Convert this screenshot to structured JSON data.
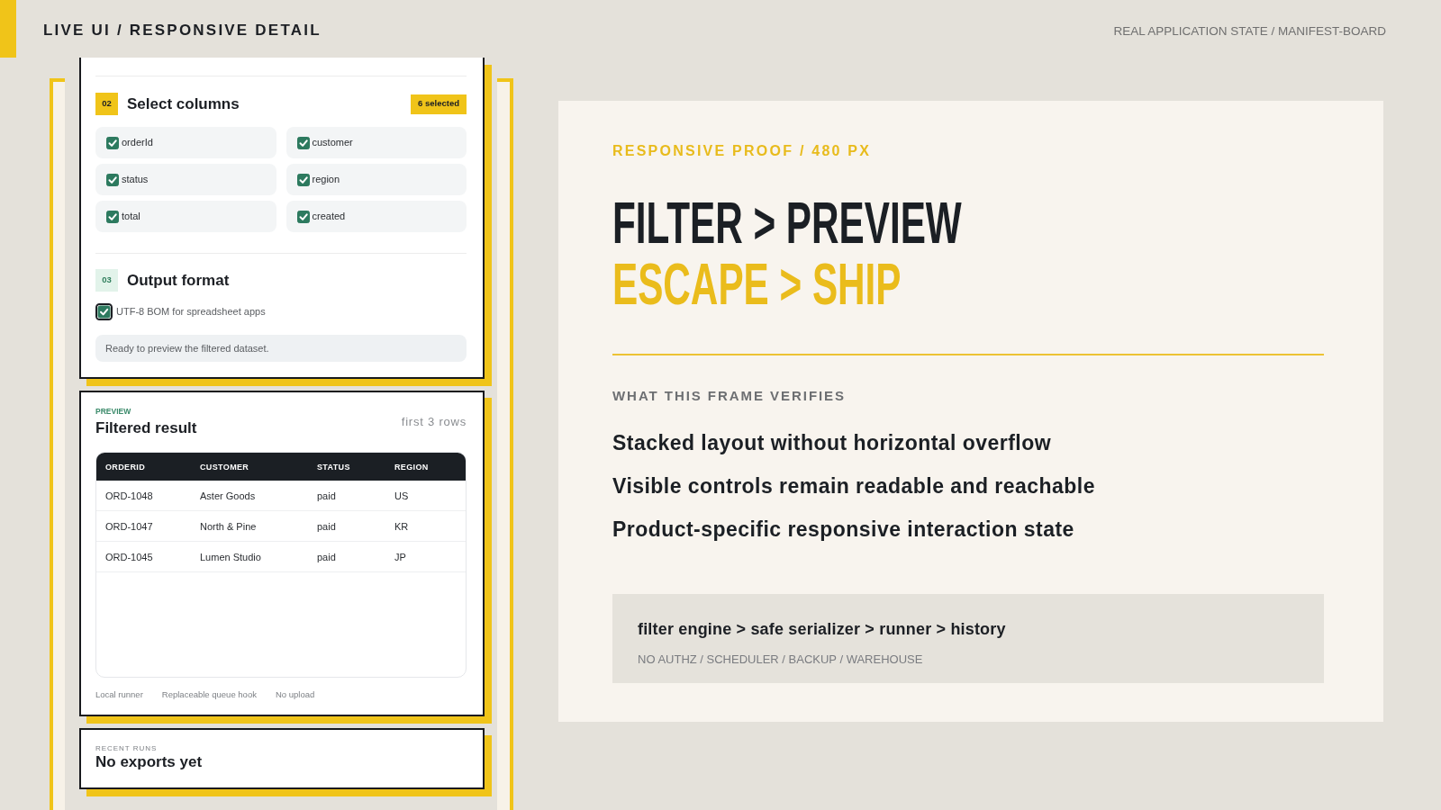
{
  "header": {
    "title": "LIVE UI / RESPONSIVE DETAIL",
    "context": "REAL APPLICATION STATE / MANIFEST-BOARD"
  },
  "device_preview": {
    "column_section": {
      "number": "02",
      "active": true,
      "title": "Select columns",
      "count_badge": "6 selected",
      "options": [
        {
          "label": "orderId",
          "checked": true
        },
        {
          "label": "customer",
          "checked": true
        },
        {
          "label": "status",
          "checked": true
        },
        {
          "label": "region",
          "checked": true
        },
        {
          "label": "total",
          "checked": true
        },
        {
          "label": "created",
          "checked": true
        }
      ]
    },
    "format_section": {
      "number": "03",
      "active": false,
      "title": "Output format",
      "option": {
        "label": "UTF-8 BOM for spreadsheet apps",
        "checked": true,
        "focused": true
      },
      "status": "Ready to preview the filtered dataset."
    },
    "preview": {
      "eyebrow": "PREVIEW",
      "title": "Filtered result",
      "meta": "first 3 rows",
      "table": {
        "columns": [
          "ORDERID",
          "CUSTOMER",
          "STATUS",
          "REGION"
        ],
        "rows": [
          [
            "ORD-1048",
            "Aster Goods",
            "paid",
            "US"
          ],
          [
            "ORD-1047",
            "North & Pine",
            "paid",
            "KR"
          ],
          [
            "ORD-1045",
            "Lumen Studio",
            "paid",
            "JP"
          ]
        ]
      },
      "notes": [
        "Local runner",
        "Replaceable queue hook",
        "No upload"
      ]
    },
    "recent_runs": {
      "eyebrow": "RECENT RUNS",
      "title": "No exports yet"
    }
  },
  "proof": {
    "eyebrow": "RESPONSIVE PROOF / 480 PX",
    "headline": [
      {
        "text": "FILTER > PREVIEW",
        "accent": false
      },
      {
        "text": "ESCAPE > SHIP",
        "accent": true
      }
    ],
    "checks_title": "WHAT THIS FRAME VERIFIES",
    "checks": [
      "Stacked layout without horizontal overflow",
      "Visible controls remain readable and reachable",
      "Product-specific responsive interaction state"
    ],
    "pipeline": {
      "flow": "filter engine > safe serializer > runner > history",
      "exclusions": "NO AUTHZ / SCHEDULER / BACKUP / WAREHOUSE"
    }
  }
}
